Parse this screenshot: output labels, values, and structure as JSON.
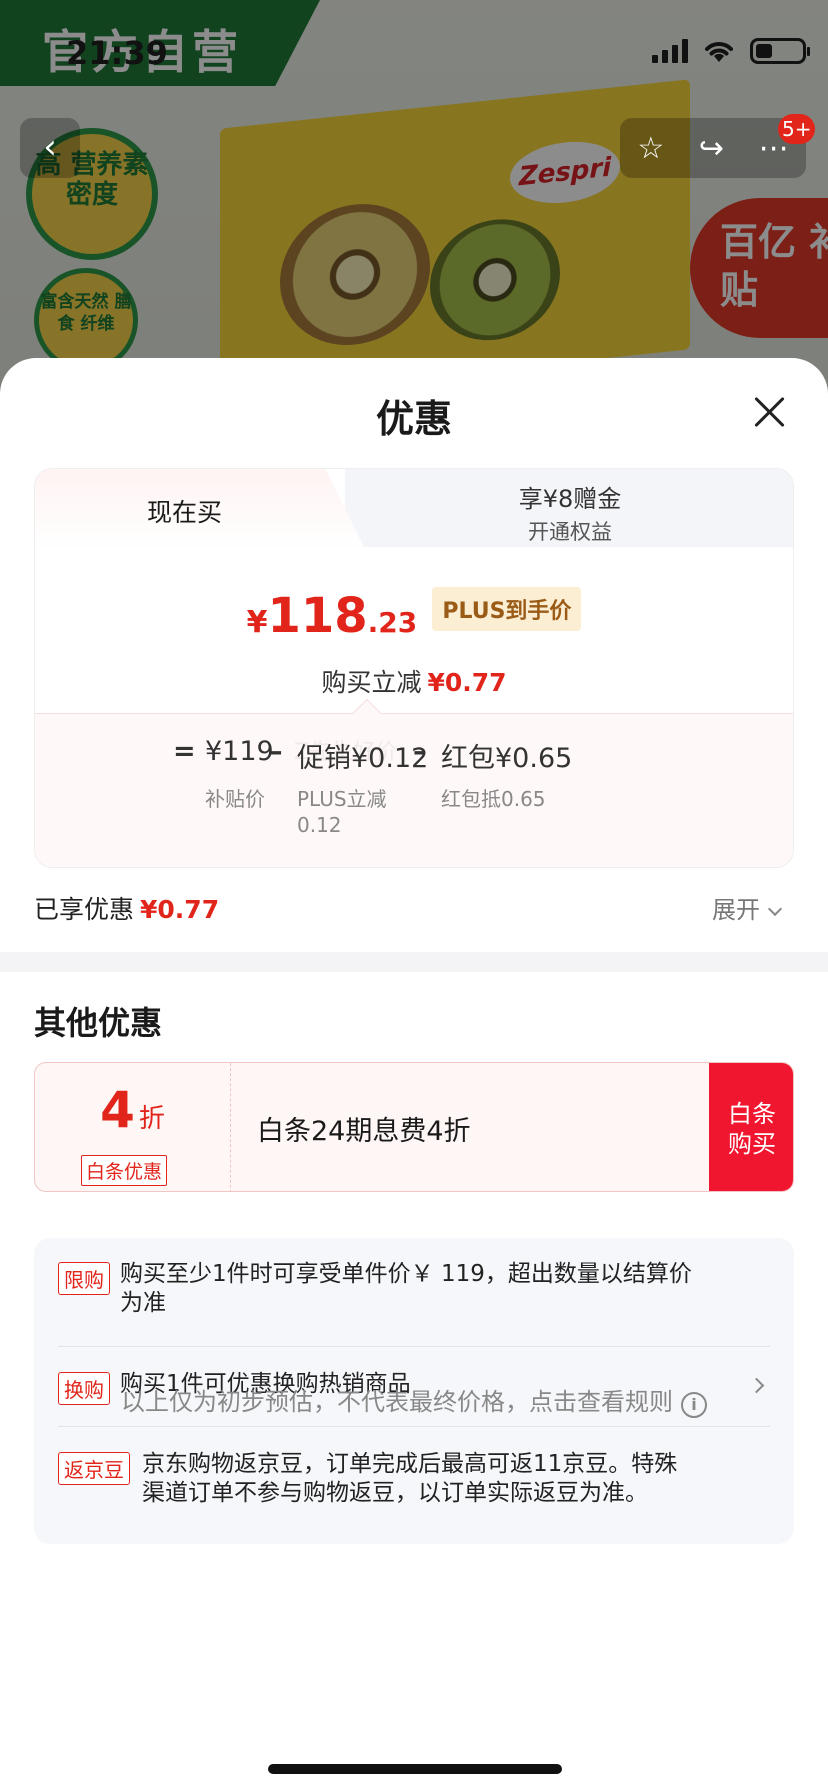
{
  "status_bar": {
    "time": "21:39"
  },
  "background": {
    "official_label": "官方自营",
    "badge1": "高 营养素 密度",
    "badge2": "富含天然 膳食 纤维",
    "brand": "Zespri",
    "subsidy_label": "百亿 补贴",
    "more_badge": "5+"
  },
  "sheet": {
    "title": "优惠",
    "tabs": {
      "active": "现在买",
      "inactive_line1": "享¥8赠金",
      "inactive_line2": "开通权益"
    },
    "price": {
      "yen": "¥",
      "integer": "118",
      "decimal": ".23",
      "tag": "PLUS到手价"
    },
    "reduce": {
      "label": "购买立减",
      "amount": "¥0.77"
    },
    "calc": {
      "equals": "=",
      "base_value": "¥119",
      "base_label": "补贴价",
      "minus1": "–",
      "promo_value": "促销¥0.12",
      "promo_label_line1": "PLUS立减",
      "promo_label_line2": "0.12",
      "minus2": "–",
      "redpack_value": "红包¥0.65",
      "redpack_label": "红包抵0.65"
    },
    "watermark": "Z先生好价",
    "enjoyed": {
      "label": "已享优惠",
      "amount": "¥0.77"
    },
    "expand_label": "展开",
    "other_title": "其他优惠",
    "coupon": {
      "number": "4",
      "unit": "折",
      "badge": "白条优惠",
      "description": "白条24期息费4折",
      "button_line1": "白条",
      "button_line2": "购买"
    },
    "info_items": [
      {
        "tag": "限购",
        "text_line1": "购买至少1件时可享受单件价￥ 119，超出数量以结算价",
        "text_line2": "为准"
      },
      {
        "tag": "换购",
        "text_line1": "购买1件可优惠换购热销商品",
        "text_line2": ""
      },
      {
        "tag": "返京豆",
        "text_line1": "京东购物返京豆，订单完成后最高可返11京豆。特殊",
        "text_line2": "渠道订单不参与购物返豆，以订单实际返豆为准。"
      }
    ],
    "footer_note": "以上仅为初步预估，不代表最终价格，点击查看规则",
    "footer_icon": "i"
  },
  "colors": {
    "accent_red": "#e1251b",
    "button_red": "#f1162f",
    "plus_tag_bg": "#fbeed2",
    "plus_tag_text": "#9a5b17"
  }
}
